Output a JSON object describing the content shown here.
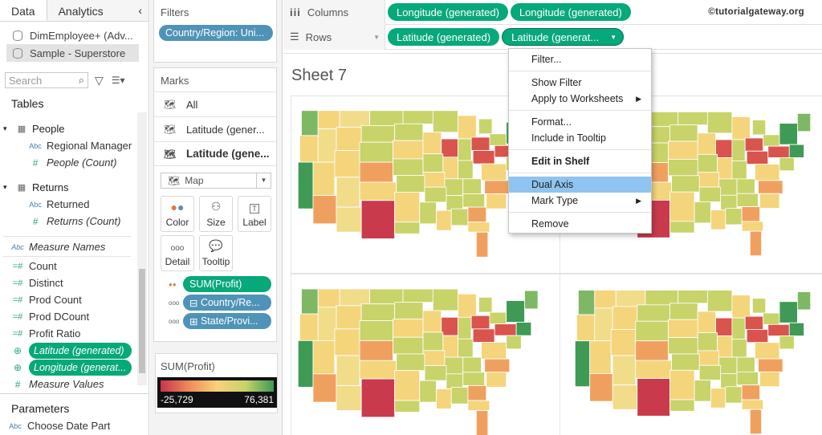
{
  "data_pane": {
    "tabs": [
      "Data",
      "Analytics"
    ],
    "collapse_glyph": "‹",
    "datasources": [
      "DimEmployee+ (Adv...",
      "Sample - Superstore"
    ],
    "search": {
      "placeholder": "Search"
    },
    "tables_heading": "Tables",
    "groups": [
      {
        "name": "People",
        "fields": [
          {
            "label": "Regional Manager",
            "type": "Abc"
          },
          {
            "label": "People (Count)",
            "type": "#"
          }
        ]
      },
      {
        "name": "Returns",
        "fields": [
          {
            "label": "Returned",
            "type": "Abc"
          },
          {
            "label": "Returns (Count)",
            "type": "#"
          }
        ]
      }
    ],
    "measure_names": "Measure Names",
    "measures": [
      "Count",
      "Distinct",
      "Prod Count",
      "Prod DCount",
      "Profit Ratio"
    ],
    "generated": [
      "Latitude (generated)",
      "Longitude (generat..."
    ],
    "measure_values": "Measure Values",
    "parameters_heading": "Parameters",
    "parameter": "Choose Date Part"
  },
  "filters": {
    "title": "Filters",
    "pill": "Country/Region: Uni..."
  },
  "marks": {
    "title": "Marks",
    "rows": [
      "All",
      "Latitude (gener...",
      "Latitude (gene..."
    ],
    "mark_type": "Map",
    "buttons": [
      "Color",
      "Size",
      "Label",
      "Detail",
      "Tooltip"
    ],
    "pills": [
      "SUM(Profit)",
      "Country/Re...",
      "State/Provi..."
    ]
  },
  "legend": {
    "title": "SUM(Profit)",
    "min": "-25,729",
    "max": "76,381"
  },
  "shelves": {
    "columns_label": "Columns",
    "rows_label": "Rows",
    "columns_pills": [
      "Longitude (generated)",
      "Longitude (generated)"
    ],
    "rows_pills": [
      "Latitude (generated)",
      "Latitude (generat..."
    ],
    "watermark": "©tutorialgateway.org"
  },
  "sheet_title": "Sheet 7",
  "context_menu": {
    "items": [
      "Filter...",
      "Show Filter",
      "Apply to Worksheets",
      "Format...",
      "Include in Tooltip",
      "Edit in Shelf",
      "Dual Axis",
      "Mark Type",
      "Remove"
    ],
    "highlighted": "Dual Axis"
  },
  "colors": {
    "accent_green": "#07a87a",
    "filter_blue": "#4f93b8",
    "menu_highlight": "#8ec4ef"
  }
}
